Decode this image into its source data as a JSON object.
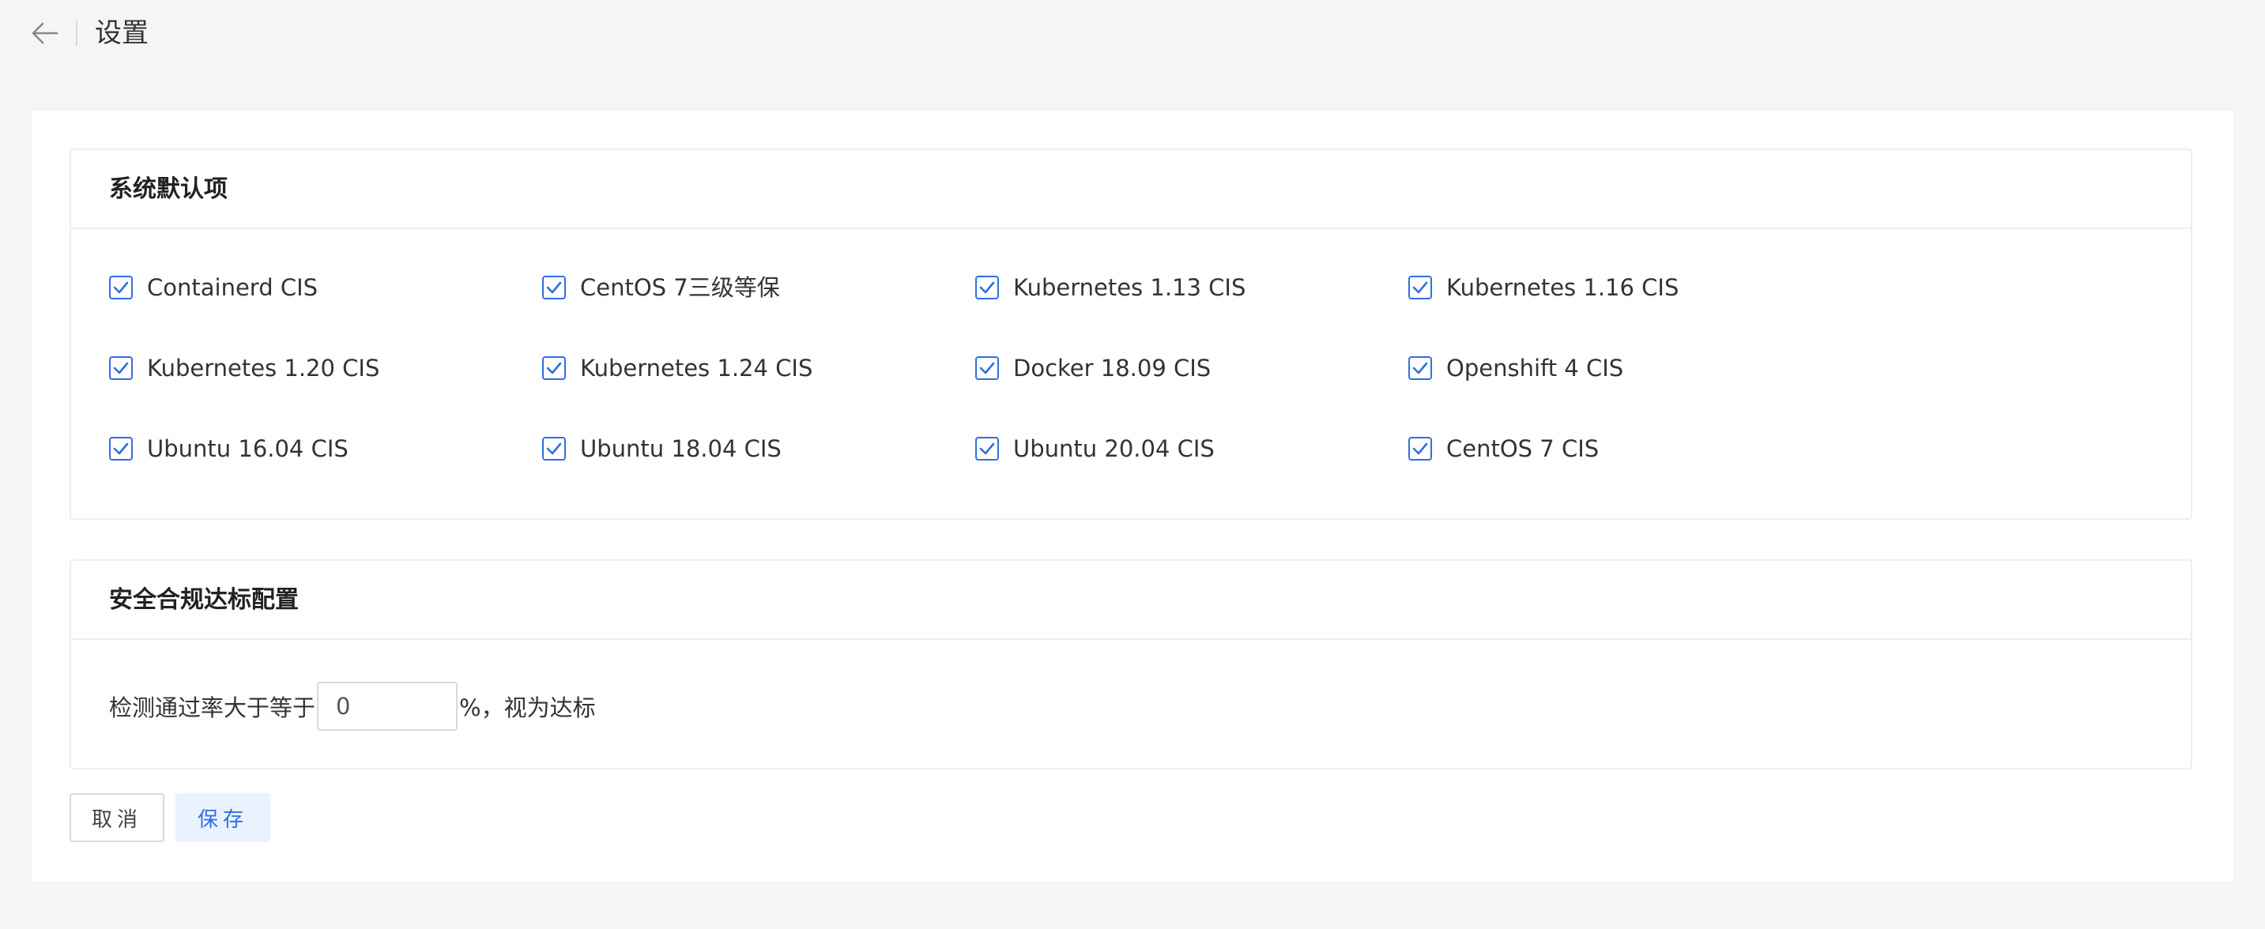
{
  "header": {
    "title": "设置"
  },
  "defaults_section": {
    "title": "系统默认项",
    "items": [
      {
        "label": "Containerd CIS",
        "checked": true
      },
      {
        "label": "CentOS 7三级等保",
        "checked": true
      },
      {
        "label": "Kubernetes 1.13 CIS",
        "checked": true
      },
      {
        "label": "Kubernetes 1.16 CIS",
        "checked": true
      },
      {
        "label": "Kubernetes 1.20 CIS",
        "checked": true
      },
      {
        "label": "Kubernetes 1.24 CIS",
        "checked": true
      },
      {
        "label": "Docker 18.09 CIS",
        "checked": true
      },
      {
        "label": "Openshift 4 CIS",
        "checked": true
      },
      {
        "label": "Ubuntu 16.04 CIS",
        "checked": true
      },
      {
        "label": "Ubuntu 18.04 CIS",
        "checked": true
      },
      {
        "label": "Ubuntu 20.04 CIS",
        "checked": true
      },
      {
        "label": "CentOS 7 CIS",
        "checked": true
      }
    ]
  },
  "compliance_section": {
    "title": "安全合规达标配置",
    "prefix": "检测通过率大于等于",
    "value": "0",
    "suffix": "%，视为达标"
  },
  "actions": {
    "cancel_label": "取消",
    "save_label": "保存"
  },
  "colors": {
    "accent": "#2f6fe4",
    "save_bg": "#eaf2ff",
    "page_bg": "#f4f5f7"
  }
}
